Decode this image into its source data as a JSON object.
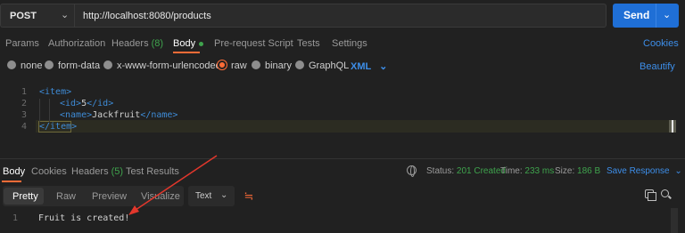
{
  "request": {
    "method": "POST",
    "url": "http://localhost:8080/products",
    "send_label": "Send"
  },
  "request_tabs": [
    {
      "label": "Params"
    },
    {
      "label": "Authorization"
    },
    {
      "label": "Headers",
      "count": "(8)"
    },
    {
      "label": "Body"
    },
    {
      "label": "Pre-request Script"
    },
    {
      "label": "Tests"
    },
    {
      "label": "Settings"
    }
  ],
  "cookies_link": "Cookies",
  "body_types": [
    {
      "label": "none",
      "selected": false
    },
    {
      "label": "form-data",
      "selected": false
    },
    {
      "label": "x-www-form-urlencoded",
      "selected": false
    },
    {
      "label": "raw",
      "selected": true
    },
    {
      "label": "binary",
      "selected": false
    },
    {
      "label": "GraphQL",
      "selected": false
    }
  ],
  "raw_format": "XML",
  "beautify_link": "Beautify",
  "editor": {
    "line_numbers": [
      "1",
      "2",
      "3",
      "4"
    ],
    "lines": {
      "l1_open": "<item>",
      "l2_open": "<id>",
      "l2_text": "5",
      "l2_close": "</id>",
      "l3_open": "<name>",
      "l3_text": "Jackfruit",
      "l3_close": "</name>",
      "l4_close": "</item>"
    }
  },
  "response_tabs": [
    {
      "label": "Body"
    },
    {
      "label": "Cookies"
    },
    {
      "label": "Headers",
      "count": "(5)"
    },
    {
      "label": "Test Results"
    }
  ],
  "response_meta": {
    "status_label": "Status:",
    "status_value": "201 Created",
    "time_label": "Time:",
    "time_value": "233 ms",
    "size_label": "Size:",
    "size_value": "186 B"
  },
  "save_response": "Save Response",
  "view_modes": [
    "Pretty",
    "Raw",
    "Preview",
    "Visualize"
  ],
  "response_format": "Text",
  "response_body": {
    "line_numbers": [
      "1"
    ],
    "text": "Fruit is created!"
  },
  "colors": {
    "accent": "#ff6c37",
    "link": "#3d8ee9",
    "send": "#1f6fd6",
    "success": "#3fa34d",
    "annotation_arrow": "#e2372c"
  },
  "icons": [
    "chevron-down-icon",
    "globe-icon",
    "wrap-lines-icon",
    "copy-icon",
    "search-icon"
  ]
}
